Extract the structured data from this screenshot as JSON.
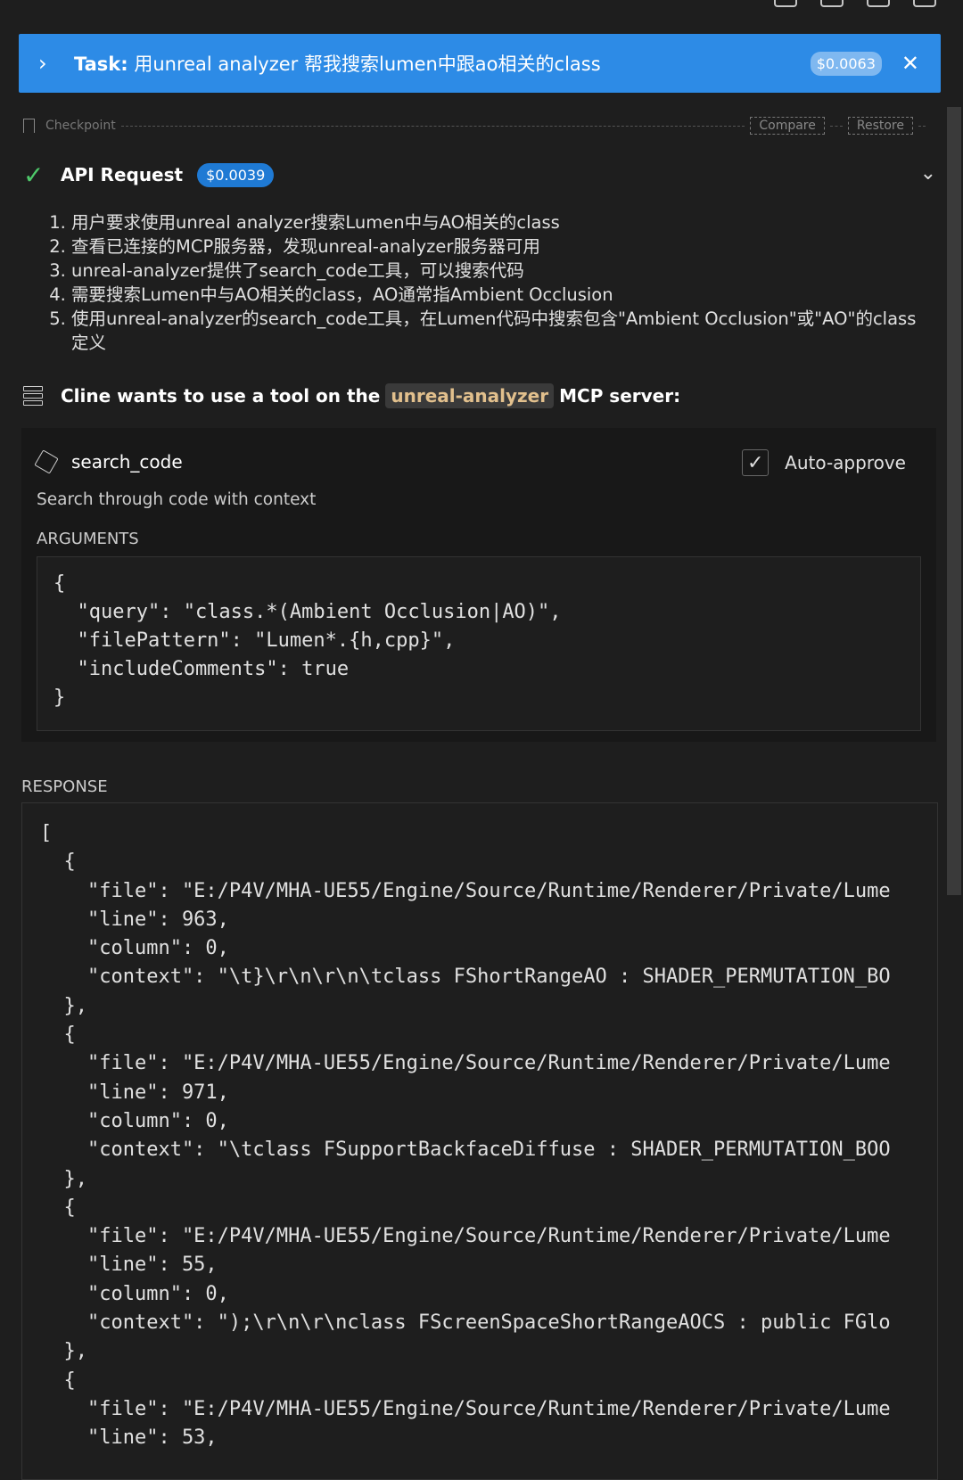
{
  "task": {
    "prefix": "Task:",
    "text": " 用unreal analyzer 帮我搜索lumen中跟ao相关的class",
    "cost": "$0.0063"
  },
  "checkpoint": {
    "label": "Checkpoint",
    "compare": "Compare",
    "restore": "Restore"
  },
  "api": {
    "label": "API Request",
    "cost": "$0.0039",
    "steps": [
      "用户要求使用unreal analyzer搜索Lumen中与AO相关的class",
      "查看已连接的MCP服务器，发现unreal-analyzer服务器可用",
      "unreal-analyzer提供了search_code工具，可以搜索代码",
      "需要搜索Lumen中与AO相关的class，AO通常指Ambient Occlusion",
      "使用unreal-analyzer的search_code工具，在Lumen代码中搜索包含\"Ambient Occlusion\"或\"AO\"的class定义"
    ]
  },
  "mcp": {
    "prefix": "Cline wants to use a tool on the",
    "server": "unreal-analyzer",
    "suffix": "MCP server:"
  },
  "tool": {
    "name": "search_code",
    "auto_approve": "Auto-approve",
    "description": "Search through code with context",
    "arguments_label": "ARGUMENTS",
    "arguments": "{\n  \"query\": \"class.*(Ambient Occlusion|AO)\",\n  \"filePattern\": \"Lumen*.{h,cpp}\",\n  \"includeComments\": true\n}"
  },
  "response": {
    "label": "RESPONSE",
    "text": "[\n  {\n    \"file\": \"E:/P4V/MHA-UE55/Engine/Source/Runtime/Renderer/Private/Lume\n    \"line\": 963,\n    \"column\": 0,\n    \"context\": \"\\t}\\r\\n\\r\\n\\tclass FShortRangeAO : SHADER_PERMUTATION_BO\n  },\n  {\n    \"file\": \"E:/P4V/MHA-UE55/Engine/Source/Runtime/Renderer/Private/Lume\n    \"line\": 971,\n    \"column\": 0,\n    \"context\": \"\\tclass FSupportBackfaceDiffuse : SHADER_PERMUTATION_BOO\n  },\n  {\n    \"file\": \"E:/P4V/MHA-UE55/Engine/Source/Runtime/Renderer/Private/Lume\n    \"line\": 55,\n    \"column\": 0,\n    \"context\": \");\\r\\n\\r\\nclass FScreenSpaceShortRangeAOCS : public FGlo\n  },\n  {\n    \"file\": \"E:/P4V/MHA-UE55/Engine/Source/Runtime/Renderer/Private/Lume\n    \"line\": 53,"
  }
}
